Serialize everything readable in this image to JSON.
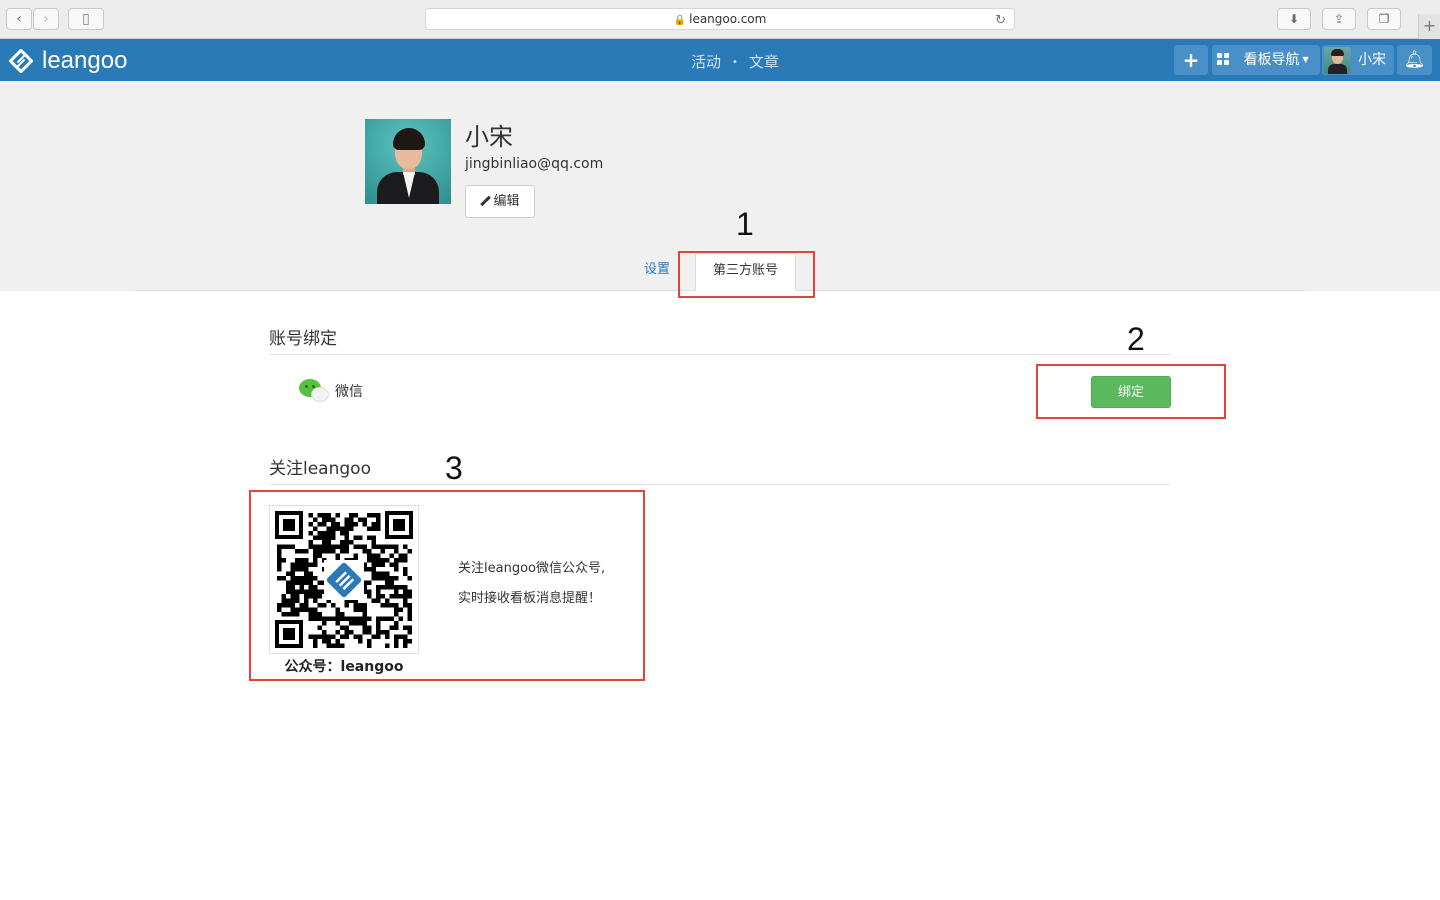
{
  "browser": {
    "url": "leangoo.com"
  },
  "appbar": {
    "brand": "leangoo",
    "nav_activity": "活动",
    "nav_separator": "•",
    "nav_articles": "文章",
    "add_label": "+",
    "board_nav_label": "看板导航",
    "user_name": "小宋"
  },
  "profile": {
    "name": "小宋",
    "email": "jingbinliao@qq.com",
    "edit_label": "编辑"
  },
  "tabs": {
    "settings": "设置",
    "third_party": "第三方账号"
  },
  "annotations": [
    "1",
    "2",
    "3"
  ],
  "binding": {
    "title": "账号绑定",
    "wechat_label": "微信",
    "bind_label": "绑定"
  },
  "follow": {
    "title": "关注leangoo",
    "caption": "公众号：leangoo",
    "line1": "关注leangoo微信公众号,",
    "line2": "实时接收看板消息提醒！"
  },
  "colors": {
    "header": "#2a7ab8",
    "bind_button": "#5cb85c",
    "annotation": "#e0453a"
  }
}
